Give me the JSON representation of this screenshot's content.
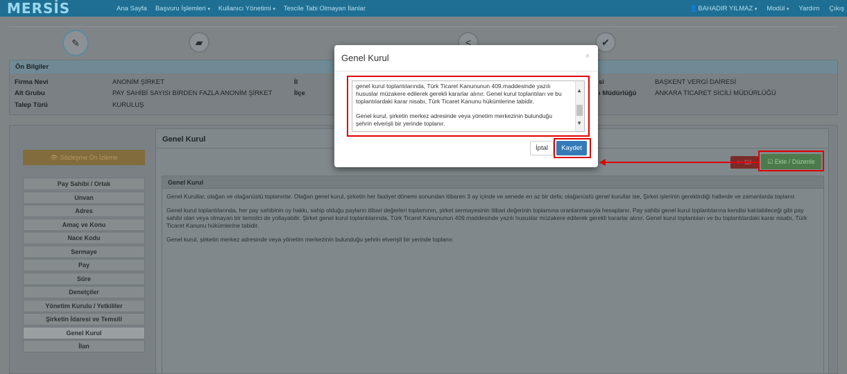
{
  "topnav": {
    "logo": "MERSİS",
    "items": [
      "Ana Sayfa",
      "Başvuru İşlemleri",
      "Kullanıcı Yönetimi",
      "Tescile Tabi Olmayan İlanlar"
    ],
    "user": "BAHADIR YILMAZ",
    "modul": "Modül",
    "yardim": "Yardım",
    "cikis": "Çıkış"
  },
  "steps": {
    "icons": [
      "pencil-icon",
      "folder-icon",
      "bank-icon",
      "share-icon",
      "check-icon"
    ],
    "glyphs": [
      "✎",
      "▰",
      "⌂",
      "<",
      "✔"
    ]
  },
  "info": {
    "header": "Ön Bilgiler",
    "firma_nevi_label": "Firma Nevi",
    "firma_nevi_value": "ANONİM ŞİRKET",
    "alt_grubu_label": "Alt Grubu",
    "alt_grubu_value": "PAY SAHİBİ SAYISI BİRDEN FAZLA ANONİM ŞİRKET",
    "talep_turu_label": "Talep Türü",
    "talep_turu_value": "KURULUŞ",
    "il_label": "İl",
    "ilce_label": "İlçe",
    "vergi_label_partial": "si",
    "vergi_value": "BAŞKENT VERGİ DAİRESİ",
    "sicil_label_partial": "ı Müdürlüğü",
    "sicil_value": "ANKARA TİCARET SİCİLİ MÜDÜRLÜĞÜ"
  },
  "sidebar": {
    "preview_button": "Sözleşme Ön İzleme",
    "items": [
      "Pay Sahibi / Ortak",
      "Unvan",
      "Adres",
      "Amaç ve Konu",
      "Nace Kodu",
      "Sermaye",
      "Pay",
      "Süre",
      "Denetçiler",
      "Yönetim Kurulu / Yetkililer",
      "Şirketin İdaresi ve Temsili",
      "Genel Kurul",
      "İlan"
    ],
    "active": "Genel Kurul"
  },
  "content": {
    "title": "Genel Kurul",
    "sil_button": "Sil",
    "ekle_button": "Ekle / Düzenle",
    "inner_header": "Genel Kurul",
    "paragraphs": [
      "Genel Kurullar, olağan ve olağanüstü toplanırlar. Olağan genel kurul, şirketin her faaliyet dönemi sonundan itibaren 3 ay içinde ve senede en az bir defa; olağanüstü genel kurullar ise, Şirket işlerinin gerektirdiği hallerde ve zamanlarda toplanır.",
      "Genel kurul toplantılarında, her pay sahibinin oy hakkı, sahip olduğu payların itibari değerleri toplamının, şirket sermayesinin itibari değerinin toplamına oranlanmasıyla hesaplanır. Pay sahibi genel kurul toplantılarına kendisi katılabileceği gibi pay sahibi olan veya olmayan bir temsilci de yollayabilir. Şirket genel kurul toplantılarında, Türk Ticaret Kanununun 409.maddesinde yazılı hususlar müzakere edilerek gerekli kararlar alınır. Genel kurul toplantıları ve bu toplantılardaki karar nisabı, Türk Ticaret Kanunu hükümlerine tabidir.",
      "Genel kurul, şirketin merkez adresinde veya yönetim merkezinin bulunduğu şehrin elverişli bir yerinde toplanır."
    ]
  },
  "modal": {
    "title": "Genel Kurul",
    "close": "×",
    "textarea_paragraphs": [
      "genel kurul toplantılarında, Türk Ticaret Kanununun 409.maddesinde yazılı hususlar müzakere edilerek gerekli kararlar alınır. Genel kurul toplantıları ve bu toplantılardaki karar nisabı, Türk Ticaret Kanunu hükümlerine tabidir.",
      "Genel kurul, şirketin merkez adresinde veya yönetim merkezinin bulunduğu şehrin elverişli bir yerinde toplanır."
    ],
    "iptal_button": "İptal",
    "kaydet_button": "Kaydet"
  },
  "colors": {
    "annotation_red": "#e00000",
    "primary_blue": "#337ab7",
    "nav_blue": "#1e6f93"
  }
}
